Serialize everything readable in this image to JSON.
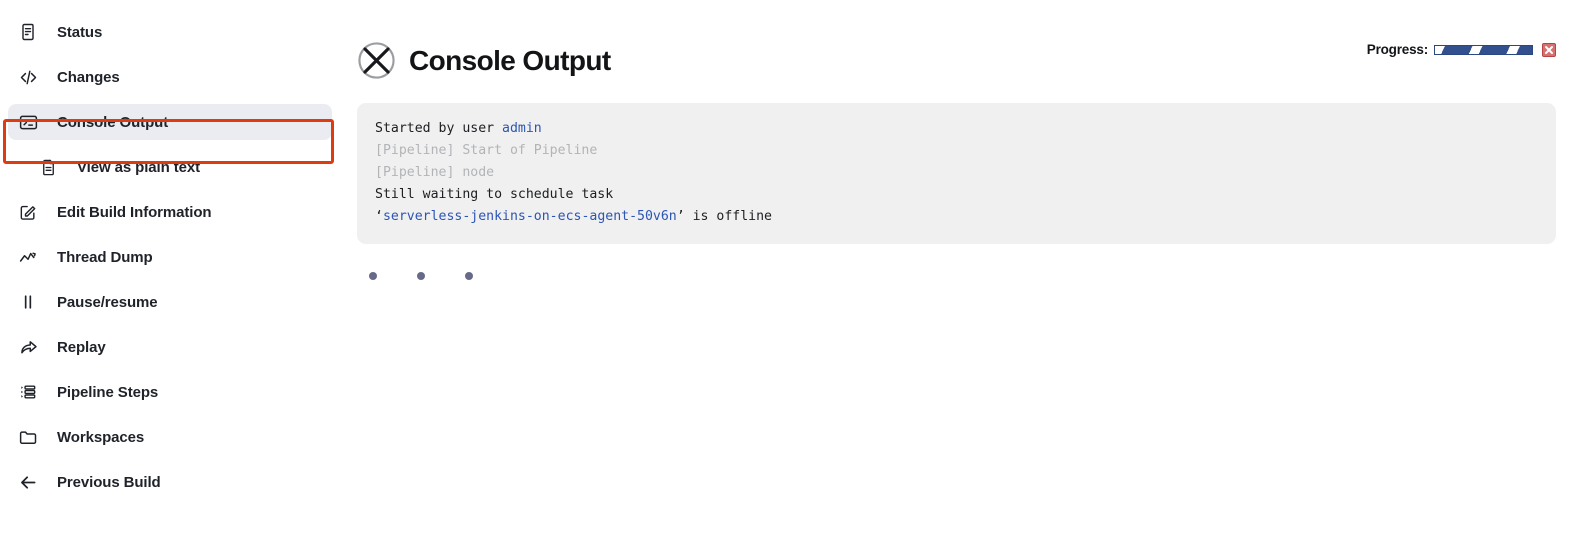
{
  "sidebar": {
    "items": [
      {
        "label": "Status",
        "icon": "document-lines-icon",
        "active": false,
        "sub": false
      },
      {
        "label": "Changes",
        "icon": "code-brackets-icon",
        "active": false,
        "sub": false
      },
      {
        "label": "Console Output",
        "icon": "terminal-icon",
        "active": true,
        "sub": false
      },
      {
        "label": "View as plain text",
        "icon": "plain-document-icon",
        "active": false,
        "sub": true
      },
      {
        "label": "Edit Build Information",
        "icon": "edit-square-icon",
        "active": false,
        "sub": false
      },
      {
        "label": "Thread Dump",
        "icon": "line-chart-icon",
        "active": false,
        "sub": false
      },
      {
        "label": "Pause/resume",
        "icon": "pause-icon",
        "active": false,
        "sub": false
      },
      {
        "label": "Replay",
        "icon": "share-arrow-icon",
        "active": false,
        "sub": false
      },
      {
        "label": "Pipeline Steps",
        "icon": "bullet-list-icon",
        "active": false,
        "sub": false
      },
      {
        "label": "Workspaces",
        "icon": "folder-icon",
        "active": false,
        "sub": false
      },
      {
        "label": "Previous Build",
        "icon": "arrow-left-icon",
        "active": false,
        "sub": false
      }
    ]
  },
  "header": {
    "title": "Console Output",
    "status_icon": "failed-circle-x-icon",
    "progress_label": "Progress:",
    "stop_icon": "stop-build-red-x-icon"
  },
  "console": {
    "lines": [
      {
        "segments": [
          {
            "text": "Started by user ",
            "style": "normal"
          },
          {
            "text": "admin",
            "style": "link"
          }
        ]
      },
      {
        "segments": [
          {
            "text": "[Pipeline] Start of Pipeline",
            "style": "muted"
          }
        ]
      },
      {
        "segments": [
          {
            "text": "[Pipeline] node",
            "style": "muted"
          }
        ]
      },
      {
        "segments": [
          {
            "text": "Still waiting to schedule task",
            "style": "normal"
          }
        ]
      },
      {
        "segments": [
          {
            "text": "‘",
            "style": "normal"
          },
          {
            "text": "serverless-jenkins-on-ecs-agent-50v6n",
            "style": "link"
          },
          {
            "text": "’ is offline",
            "style": "normal"
          }
        ]
      }
    ]
  },
  "loading": {
    "dot_count": 3
  },
  "colors": {
    "accent_link": "#2c55b4",
    "progress_blue": "#32508e",
    "stop_red": "#d05a5a",
    "annotation_red": "#dd3b12",
    "active_bg": "#ebecf2",
    "console_bg": "#f0f0f0",
    "dot": "#676a87"
  }
}
